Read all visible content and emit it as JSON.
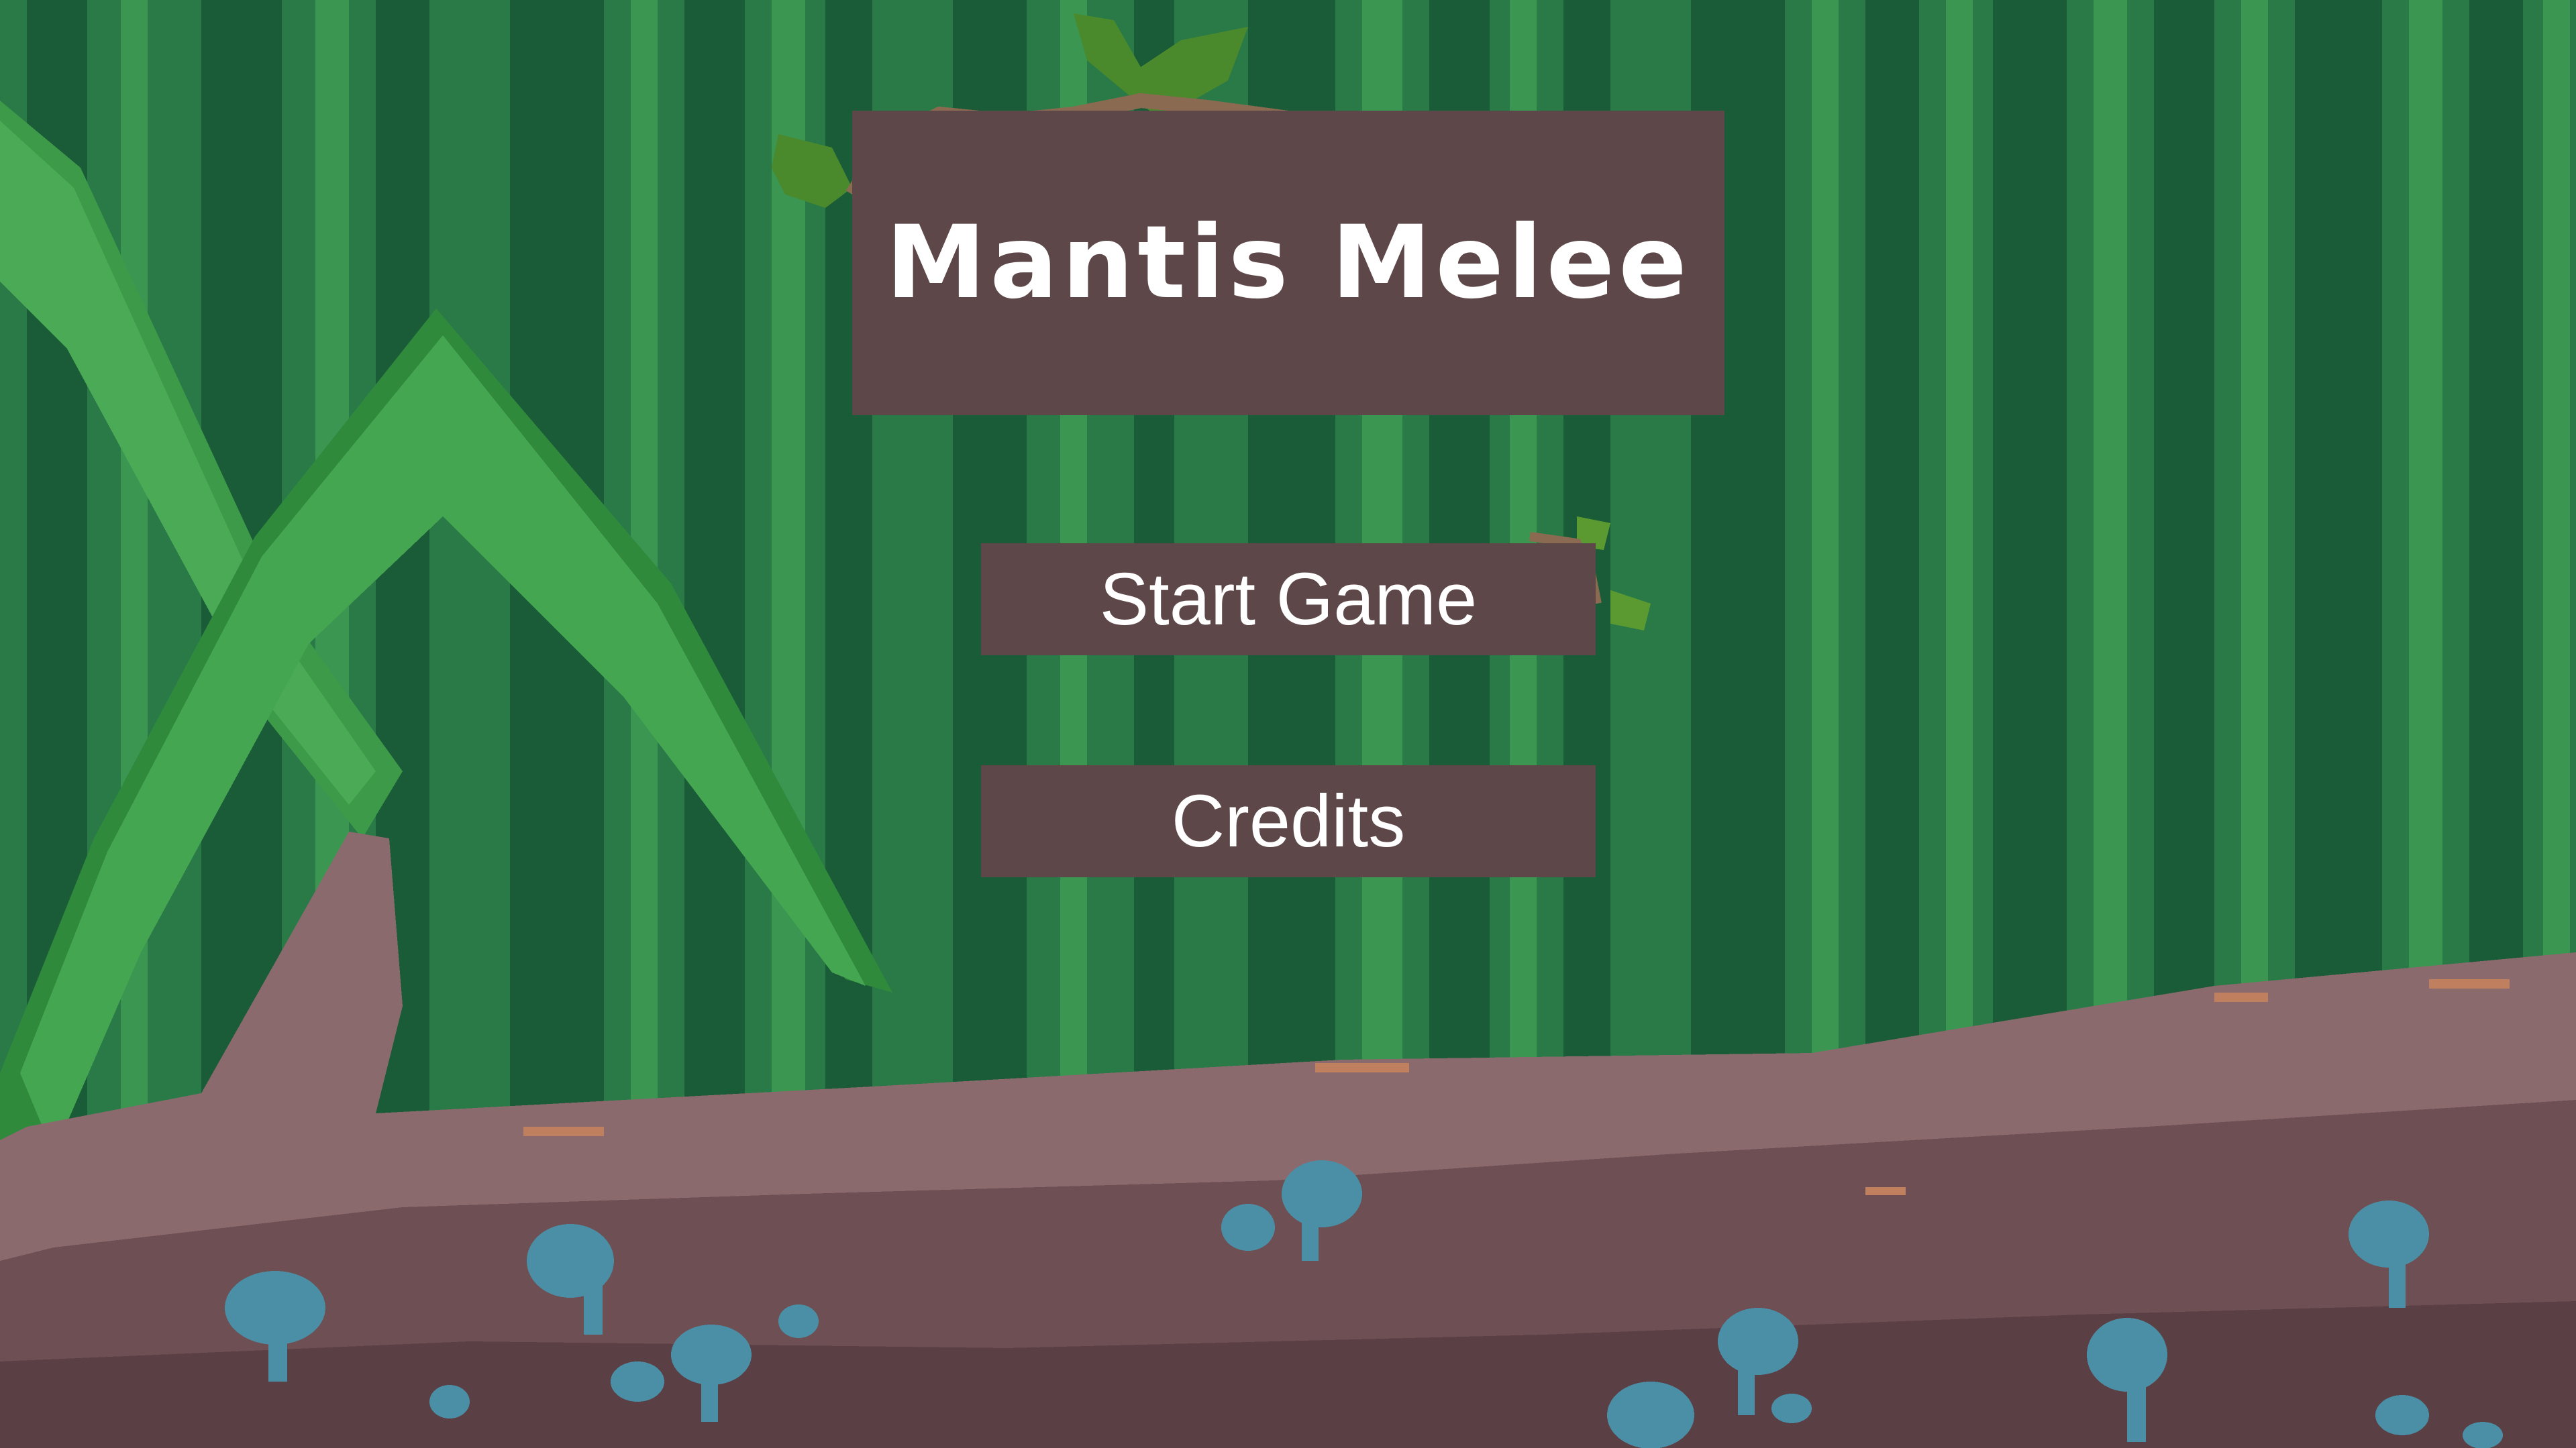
{
  "game": {
    "title": "Mantis Melee"
  },
  "menu": {
    "items": [
      {
        "label": "Start Game"
      },
      {
        "label": "Credits"
      }
    ]
  },
  "colors": {
    "sign_background": "#5e4749",
    "text": "#ffffff",
    "forest_dark": "#1a5c38",
    "forest_mid": "#2a7a48",
    "forest_light": "#3a9650",
    "log": "#8b6a6d",
    "log_shadow": "#6e4f54",
    "mushroom": "#4a8fa6"
  },
  "icons": [
    "leaf-sprout-icon",
    "mushroom-icon",
    "grass-blade-icon"
  ]
}
